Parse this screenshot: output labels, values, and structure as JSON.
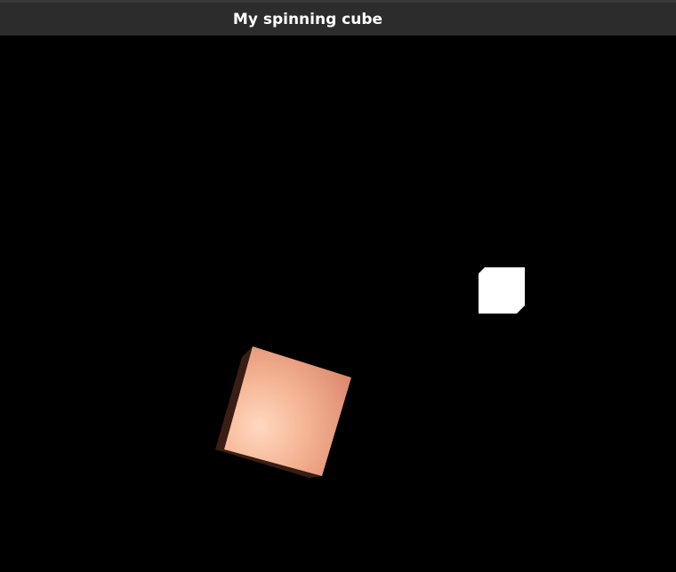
{
  "window": {
    "title": "My spinning cube"
  },
  "scene": {
    "background_color": "#000000",
    "cube": {
      "front_face_color": "#e9967a",
      "highlight_color": "#ffd8bf",
      "side_shadow_color": "#3a1d14"
    },
    "light_source": {
      "color": "#ffffff"
    }
  }
}
